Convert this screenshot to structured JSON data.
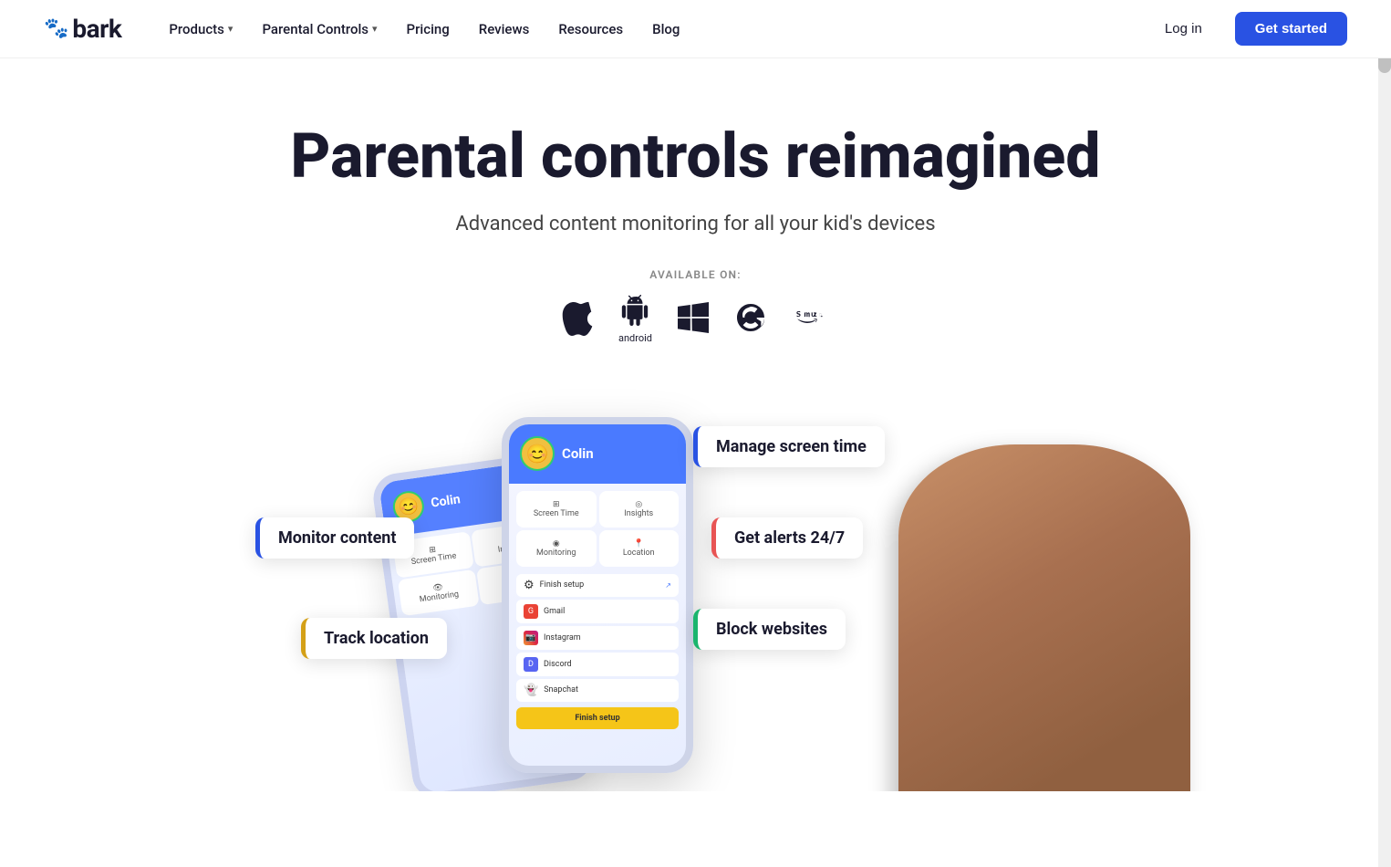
{
  "nav": {
    "logo_text": "bark",
    "logo_icon": "🐾",
    "items": [
      {
        "label": "Products",
        "has_dropdown": true
      },
      {
        "label": "Parental Controls",
        "has_dropdown": true
      },
      {
        "label": "Pricing",
        "has_dropdown": false
      },
      {
        "label": "Reviews",
        "has_dropdown": false
      },
      {
        "label": "Resources",
        "has_dropdown": false
      },
      {
        "label": "Blog",
        "has_dropdown": false
      }
    ],
    "login_label": "Log in",
    "get_started_label": "Get started"
  },
  "hero": {
    "title": "Parental controls reimagined",
    "subtitle": "Advanced content monitoring for all your kid's devices",
    "available_label": "AVAILABLE ON:"
  },
  "platforms": [
    {
      "name": "Apple / iOS",
      "icon": "apple",
      "label": ""
    },
    {
      "name": "Android",
      "icon": "android",
      "label": "android"
    },
    {
      "name": "Windows",
      "icon": "windows",
      "label": ""
    },
    {
      "name": "Chrome",
      "icon": "chrome",
      "label": ""
    },
    {
      "name": "Amazon",
      "icon": "amazon",
      "label": ""
    }
  ],
  "feature_tags": [
    {
      "id": "manage-screen-time",
      "label": "Manage screen time",
      "color": "#2952e3"
    },
    {
      "id": "get-alerts",
      "label": "Get alerts 24/7",
      "color": "#e85454"
    },
    {
      "id": "block-websites",
      "label": "Block websites",
      "color": "#1ab56e"
    },
    {
      "id": "monitor-content",
      "label": "Monitor content",
      "color": "#2952e3"
    },
    {
      "id": "track-location",
      "label": "Track location",
      "color": "#d4a017"
    }
  ],
  "phone": {
    "child_name": "Colin",
    "grid_items": [
      {
        "icon": "⊞",
        "label": "Screen Time"
      },
      {
        "icon": "◎",
        "label": "Insights"
      },
      {
        "icon": "◉",
        "label": "Monitoring"
      },
      {
        "icon": "⊙",
        "label": "Location"
      }
    ],
    "list_items": [
      {
        "name": "Finish setup",
        "icon": "⚙"
      },
      {
        "name": "Gmail",
        "icon": "✉"
      },
      {
        "name": "Instagram",
        "icon": "📷"
      },
      {
        "name": "Discord",
        "icon": "💬"
      },
      {
        "name": "Snapchat",
        "icon": "👻"
      }
    ],
    "finish_bar_text": "Finish setup"
  }
}
